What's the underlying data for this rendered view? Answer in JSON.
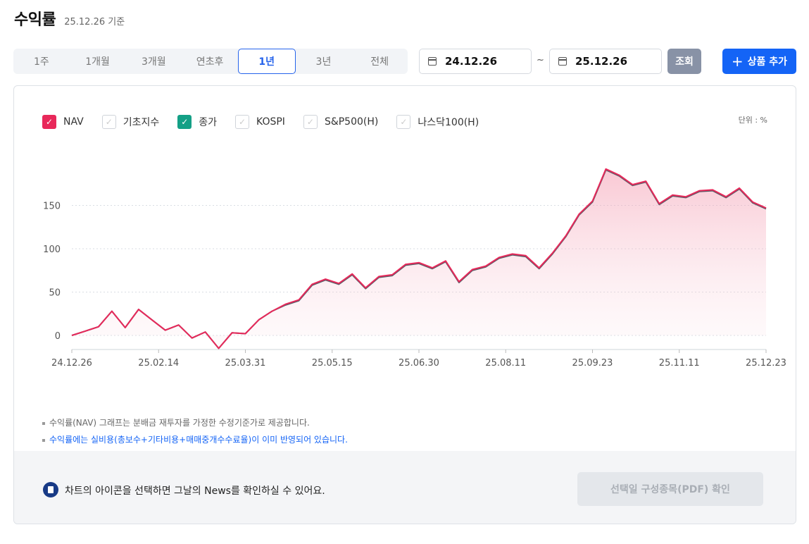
{
  "header": {
    "title": "수익률",
    "as_of": "25.12.26 기준"
  },
  "period_tabs": [
    {
      "label": "1주",
      "active": false
    },
    {
      "label": "1개월",
      "active": false
    },
    {
      "label": "3개월",
      "active": false
    },
    {
      "label": "연초후",
      "active": false
    },
    {
      "label": "1년",
      "active": true
    },
    {
      "label": "3년",
      "active": false
    },
    {
      "label": "전체",
      "active": false
    }
  ],
  "date_range": {
    "start": "24.12.26",
    "separator": "~",
    "end": "25.12.26"
  },
  "search_label": "조회",
  "add_label": "상품 추가",
  "legend": [
    {
      "label": "NAV",
      "checked": true,
      "color": "#e8285a"
    },
    {
      "label": "기초지수",
      "checked": false,
      "color": ""
    },
    {
      "label": "종가",
      "checked": true,
      "color": "#14a086"
    },
    {
      "label": "KOSPI",
      "checked": false,
      "color": ""
    },
    {
      "label": "S&P500(H)",
      "checked": false,
      "color": ""
    },
    {
      "label": "나스닥100(H)",
      "checked": false,
      "color": ""
    }
  ],
  "unit_label": "단위 : %",
  "notes": [
    "수익률(NAV) 그래프는 분배금 재투자를 가정한 수정기준가로 제공합니다.",
    "수익률에는 실비용(총보수+기타비용+매매중개수수료율)이 이미 반영되어 있습니다."
  ],
  "news_hint": "차트의 아이콘을 선택하면 그날의 News를 확인하실 수 있어요.",
  "pdf_button": "선택일 구성종목(PDF) 확인",
  "chart_data": {
    "type": "line",
    "title": "",
    "xlabel": "",
    "ylabel": "",
    "ylim": [
      -8,
      200
    ],
    "y_ticks": [
      0,
      50,
      100,
      150
    ],
    "x_tick_labels": [
      "24.12.26",
      "25.02.14",
      "25.03.31",
      "25.05.15",
      "25.06.30",
      "25.08.11",
      "25.09.23",
      "25.11.11",
      "25.12.23"
    ],
    "grid": "horizontal dotted",
    "x": [
      "24.12.26",
      "25.01.07",
      "25.01.17",
      "25.01.31",
      "25.02.07",
      "25.02.14",
      "25.02.25",
      "25.03.07",
      "25.03.17",
      "25.03.24",
      "25.03.31",
      "25.04.04",
      "25.04.09",
      "25.04.15",
      "25.04.25",
      "25.05.08",
      "25.05.15",
      "25.05.23",
      "25.06.04",
      "25.06.13",
      "25.06.20",
      "25.06.30",
      "25.07.04",
      "25.07.10",
      "25.07.16",
      "25.07.23",
      "25.07.30",
      "25.08.05",
      "25.08.11",
      "25.08.18",
      "25.08.25",
      "25.09.01",
      "25.09.08",
      "25.09.15",
      "25.09.23",
      "25.09.30",
      "25.10.06",
      "25.10.16",
      "25.10.22",
      "25.10.28",
      "25.11.03",
      "25.11.07",
      "25.11.11",
      "25.11.14",
      "25.11.19",
      "25.11.25",
      "25.12.01",
      "25.12.05",
      "25.12.10",
      "25.12.15",
      "25.12.19",
      "25.12.23",
      "25.12.26"
    ],
    "series": [
      {
        "name": "NAV",
        "color": "#e8285a",
        "values": [
          0,
          5,
          10,
          28,
          9,
          30,
          18,
          6,
          12,
          -3,
          4,
          -15,
          3,
          2,
          18,
          28,
          36,
          41,
          59,
          65,
          60,
          71,
          55,
          68,
          70,
          82,
          84,
          78,
          86,
          62,
          76,
          80,
          90,
          94,
          92,
          78,
          95,
          115,
          140,
          155,
          192,
          185,
          174,
          178,
          152,
          162,
          160,
          167,
          168,
          160,
          170,
          154,
          147
        ]
      },
      {
        "name": "종가",
        "color": "#14a086",
        "values": [
          0,
          5,
          10,
          28,
          9,
          30,
          18,
          6,
          12,
          -3,
          4,
          -15,
          3,
          2,
          18,
          28,
          35,
          40,
          58,
          64,
          59,
          70,
          54,
          67,
          69,
          81,
          83,
          77,
          85,
          61,
          75,
          79,
          89,
          93,
          91,
          77,
          94,
          114,
          139,
          154,
          191,
          184,
          173,
          177,
          151,
          161,
          159,
          166,
          167,
          159,
          169,
          153,
          146
        ]
      }
    ]
  }
}
